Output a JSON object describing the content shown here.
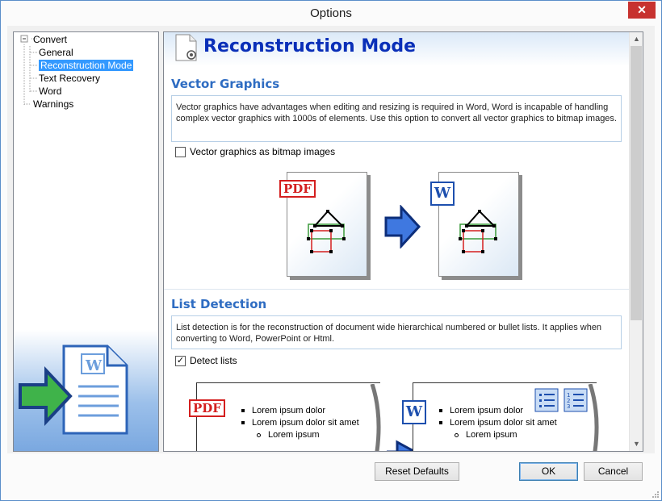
{
  "window": {
    "title": "Options",
    "close_glyph": "✕"
  },
  "tree": {
    "items": [
      {
        "label": "Convert",
        "level": 0,
        "expander": "−"
      },
      {
        "label": "General",
        "level": 1
      },
      {
        "label": "Reconstruction Mode",
        "level": 1,
        "selected": true
      },
      {
        "label": "Text Recovery",
        "level": 1
      },
      {
        "label": "Word",
        "level": 1
      },
      {
        "label": "Warnings",
        "level": 0
      }
    ],
    "logo_icon": "pdf-to-word-convert-icon"
  },
  "main": {
    "title": "Reconstruction Mode",
    "title_icon": "settings-page-icon",
    "vector": {
      "title": "Vector Graphics",
      "description": "Vector graphics have advantages when editing and resizing is required in Word, Word is incapable of handling complex vector graphics with 1000s of elements. Use this option to convert all vector graphics to bitmap images.",
      "checkbox_label": "Vector graphics as bitmap images",
      "checked": false,
      "pdf_badge": "PDF",
      "word_badge": "W"
    },
    "list": {
      "title": "List Detection",
      "description": "List detection is for the reconstruction of document wide hierarchical numbered or bullet lists. It applies when converting to Word, PowerPoint or Html.",
      "checkbox_label": "Detect lists",
      "checked": true,
      "check_glyph": "✓",
      "pdf_badge": "PDF",
      "word_badge": "W",
      "items": [
        "Lorem ipsum dolor",
        "Lorem ipsum dolor sit amet",
        "Lorem ipsum"
      ],
      "numbered_markers": [
        "1",
        "2",
        "3"
      ]
    },
    "scroll": {
      "up_glyph": "▲",
      "down_glyph": "▼"
    }
  },
  "buttons": {
    "reset": "Reset Defaults",
    "ok": "OK",
    "cancel": "Cancel"
  },
  "colors": {
    "accent_title": "#0a2fb8",
    "section_title": "#2e6cc2",
    "pdf_red": "#d41f1f",
    "word_blue": "#1d4fae",
    "selection": "#3399ff"
  }
}
